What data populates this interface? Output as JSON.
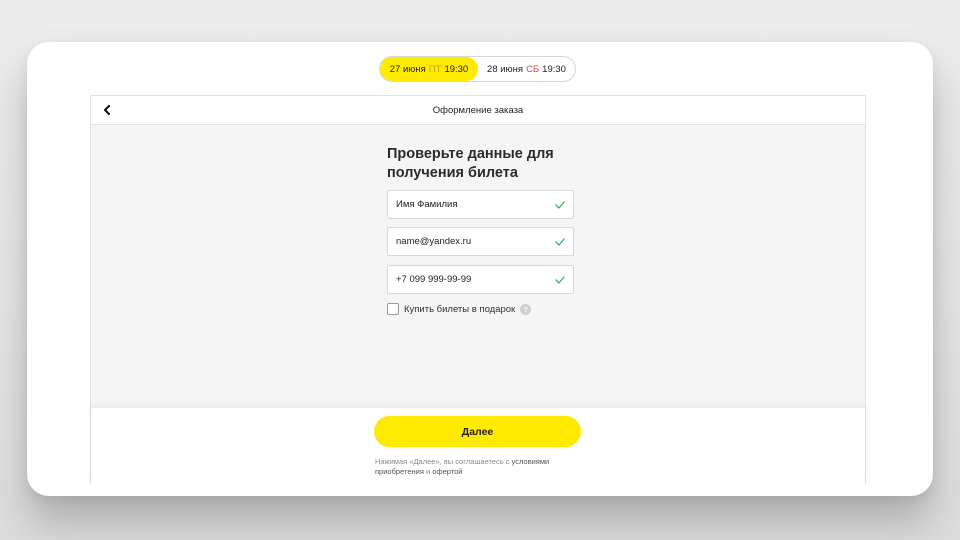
{
  "dates": {
    "tab1": {
      "date": "27 июня",
      "day": "ПТ",
      "time": "19:30"
    },
    "tab2": {
      "date": "28 июня",
      "day": "СБ",
      "time": "19:30"
    }
  },
  "header": {
    "title": "Оформление заказа"
  },
  "form": {
    "title": "Проверьте данные для получения билета",
    "name_value": "Имя Фамилия",
    "email_value": "name@yandex.ru",
    "phone_value": "+7 099 999-99-99",
    "gift_label": "Купить билеты в подарок",
    "help_symbol": "?"
  },
  "footer": {
    "next_label": "Далее",
    "terms_prefix": "Нажимая «Далее», вы соглашаетесь с ",
    "terms_link1": "условиями приобретения",
    "terms_middle": " и ",
    "terms_link2": "офертой"
  },
  "colors": {
    "accent": "#ffeb00",
    "valid": "#35b55a",
    "weekend": "#e8423a"
  },
  "icons": {
    "back": "chevron-left-icon",
    "valid": "check-icon",
    "help": "help-icon"
  }
}
